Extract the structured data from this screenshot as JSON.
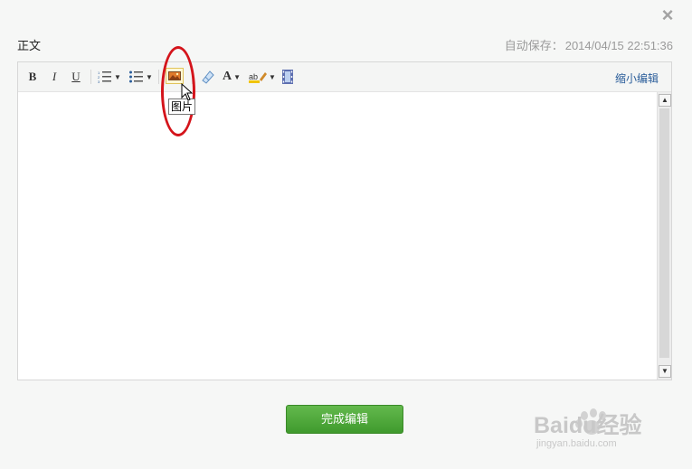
{
  "dialog": {
    "close_icon": "×",
    "title": "正文",
    "autosave_label": "自动保存：",
    "autosave_time": "2014/04/15 22:51:36"
  },
  "toolbar": {
    "bold": "B",
    "italic": "I",
    "underline": "U",
    "font_color": "A",
    "highlight": "ab",
    "shrink_label": "缩小编辑"
  },
  "tooltip": {
    "text": "图片"
  },
  "footer": {
    "done_label": "完成编辑"
  },
  "watermark": {
    "brand": "Baidu经验",
    "url": "jingyan.baidu.com"
  },
  "colors": {
    "accent_green": "#4caa39",
    "annotation_red": "#d4141b",
    "link_blue": "#2a5d9a"
  }
}
